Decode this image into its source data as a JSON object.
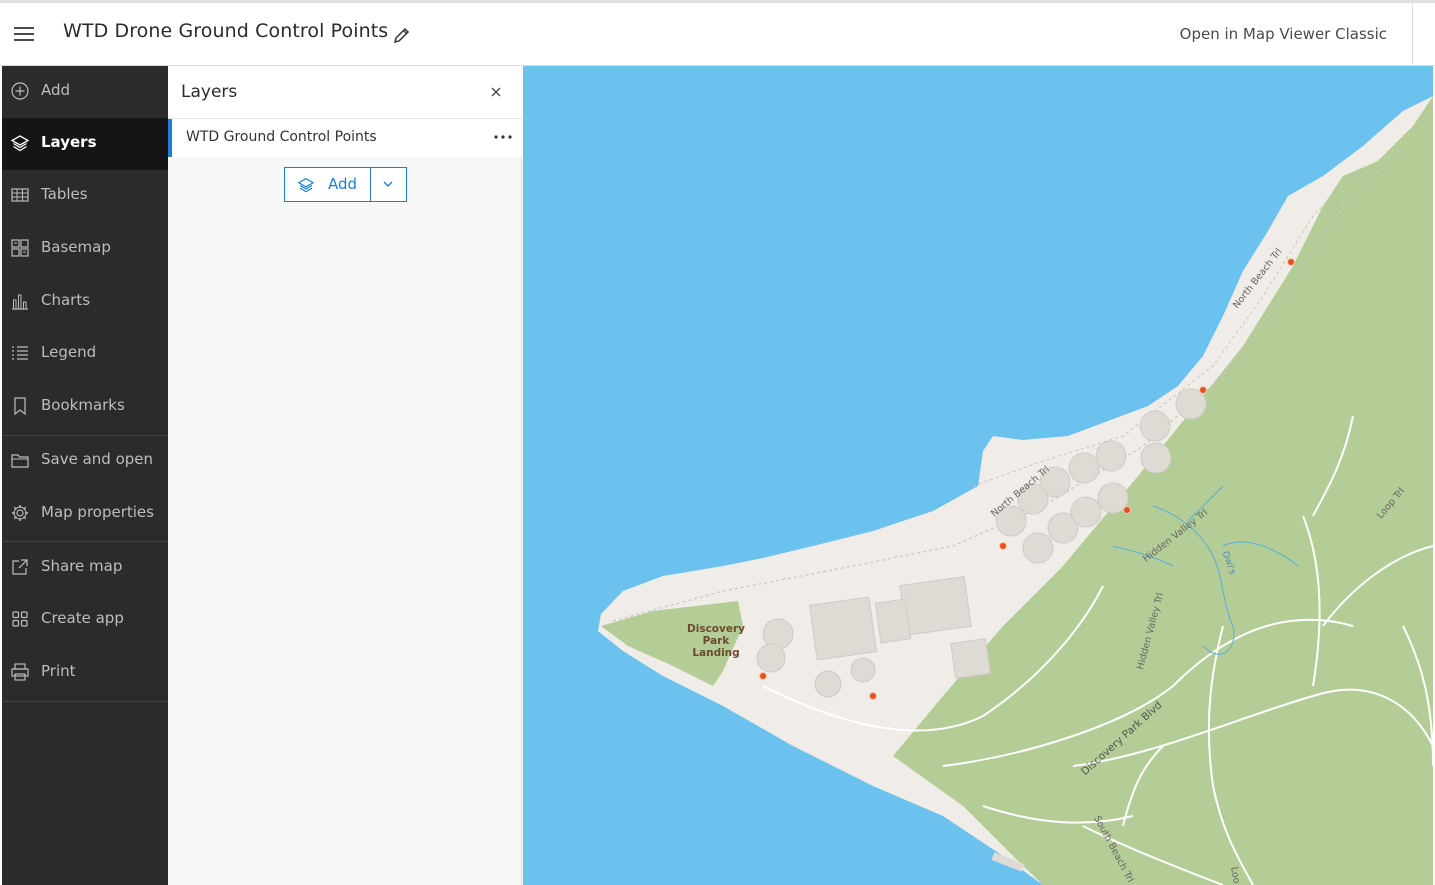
{
  "header": {
    "title": "WTD Drone Ground Control Points",
    "open_classic": "Open in Map Viewer Classic"
  },
  "sidebar": {
    "items": [
      {
        "label": "Add",
        "icon": "add-circle-icon"
      },
      {
        "label": "Layers",
        "icon": "layers-icon",
        "active": true
      },
      {
        "label": "Tables",
        "icon": "table-icon"
      },
      {
        "label": "Basemap",
        "icon": "basemap-icon"
      },
      {
        "label": "Charts",
        "icon": "chart-icon"
      },
      {
        "label": "Legend",
        "icon": "legend-icon"
      },
      {
        "label": "Bookmarks",
        "icon": "bookmark-icon"
      },
      {
        "label": "Save and open",
        "icon": "folder-icon"
      },
      {
        "label": "Map properties",
        "icon": "gear-icon"
      },
      {
        "label": "Share map",
        "icon": "share-icon"
      },
      {
        "label": "Create app",
        "icon": "apps-icon"
      },
      {
        "label": "Print",
        "icon": "printer-icon"
      }
    ]
  },
  "layers_panel": {
    "title": "Layers",
    "layer_name": "WTD Ground Control Points",
    "add_label": "Add"
  },
  "map": {
    "labels": {
      "north_beach_1": "North Beach Trl",
      "north_beach_2": "North Beach Trl",
      "hidden_valley_1": "Hidden Valley Trl",
      "hidden_valley_2": "Hidden Valley Trl",
      "discovery_park_blvd": "Discovery Park Blvd",
      "south_beach": "South Beach Trl",
      "loop_trl": "Loop Trl",
      "loop_trl_2": "Loo",
      "owls": "Owl's",
      "place": "Discovery Park Landing"
    },
    "colors": {
      "water": "#6bc2ee",
      "land": "#f0ede8",
      "park": "#b4cc96",
      "points": "#e2541f"
    }
  }
}
